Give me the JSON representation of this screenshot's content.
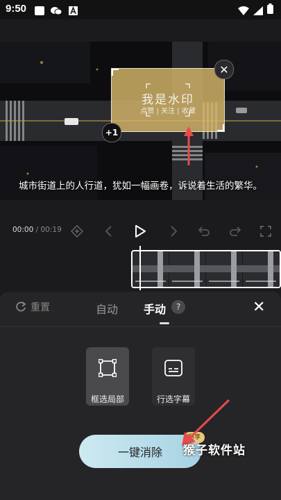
{
  "status_bar": {
    "time": "9:50"
  },
  "preview": {
    "caption": "城市街道上的人行道，犹如一幅画卷，诉说着生活的繁华。",
    "selection": {
      "watermark_title": "我是水印",
      "watermark_subtitle": "点赞 | 关注 | 收藏",
      "badge": "+1"
    }
  },
  "playback": {
    "current": "00:00",
    "separator": " / ",
    "total": "00:19"
  },
  "panel": {
    "reset_label": "重置",
    "tabs": [
      {
        "label": "自动",
        "active": false
      },
      {
        "label": "手动",
        "active": true
      }
    ],
    "help_label": "?",
    "tools": [
      {
        "label": "框选局部",
        "selected": true
      },
      {
        "label": "行选字幕",
        "selected": false
      }
    ],
    "action_button": "一键消除",
    "vip_badge": "畅享"
  },
  "site_watermark": "猴子软件站",
  "colors": {
    "panel": "#252527",
    "accent_button": "#b9dfea",
    "vip": "#e8c77d",
    "arrow": "#e84a4a"
  }
}
